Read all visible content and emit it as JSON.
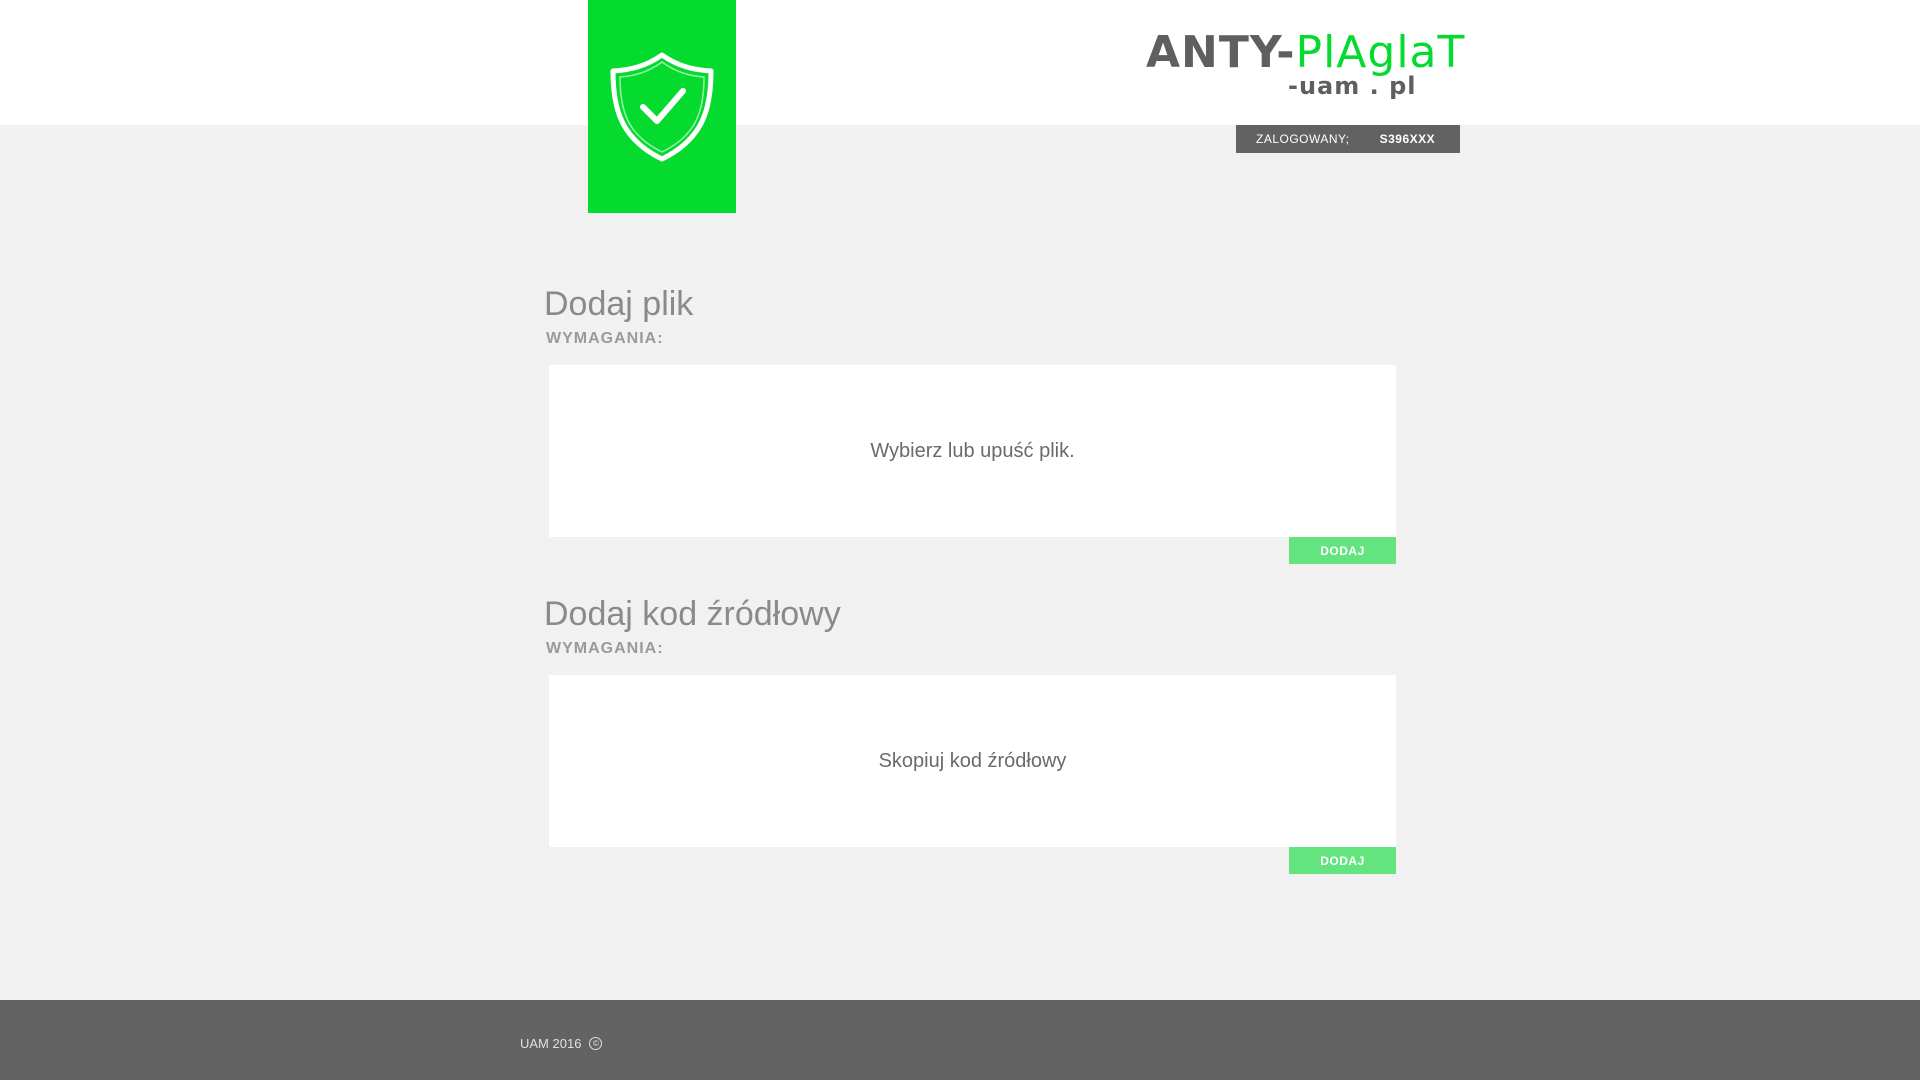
{
  "header": {
    "brand_part1": "ANTY-",
    "brand_part2": "PlAglaT",
    "brand_line2": "-uam . pl",
    "logo_icon": "shield-check-icon",
    "login_label": "ZALOGOWANY;",
    "login_user": "S396XXX"
  },
  "sections": [
    {
      "title": "Dodaj plik",
      "subtitle": "WYMAGANIA:",
      "drop_text": "Wybierz lub upuść plik.",
      "button_label": "DODAJ"
    },
    {
      "title": "Dodaj kod źródłowy",
      "subtitle": "WYMAGANIA:",
      "drop_text": "Skopiuj kod źródłowy",
      "button_label": "DODAJ"
    }
  ],
  "footer": {
    "text": "UAM 2016",
    "copyright_symbol": "©"
  },
  "colors": {
    "accent_green": "#05db2e",
    "button_green": "#63e47e",
    "dark_gray": "#636363",
    "background": "#f1f1f1"
  }
}
